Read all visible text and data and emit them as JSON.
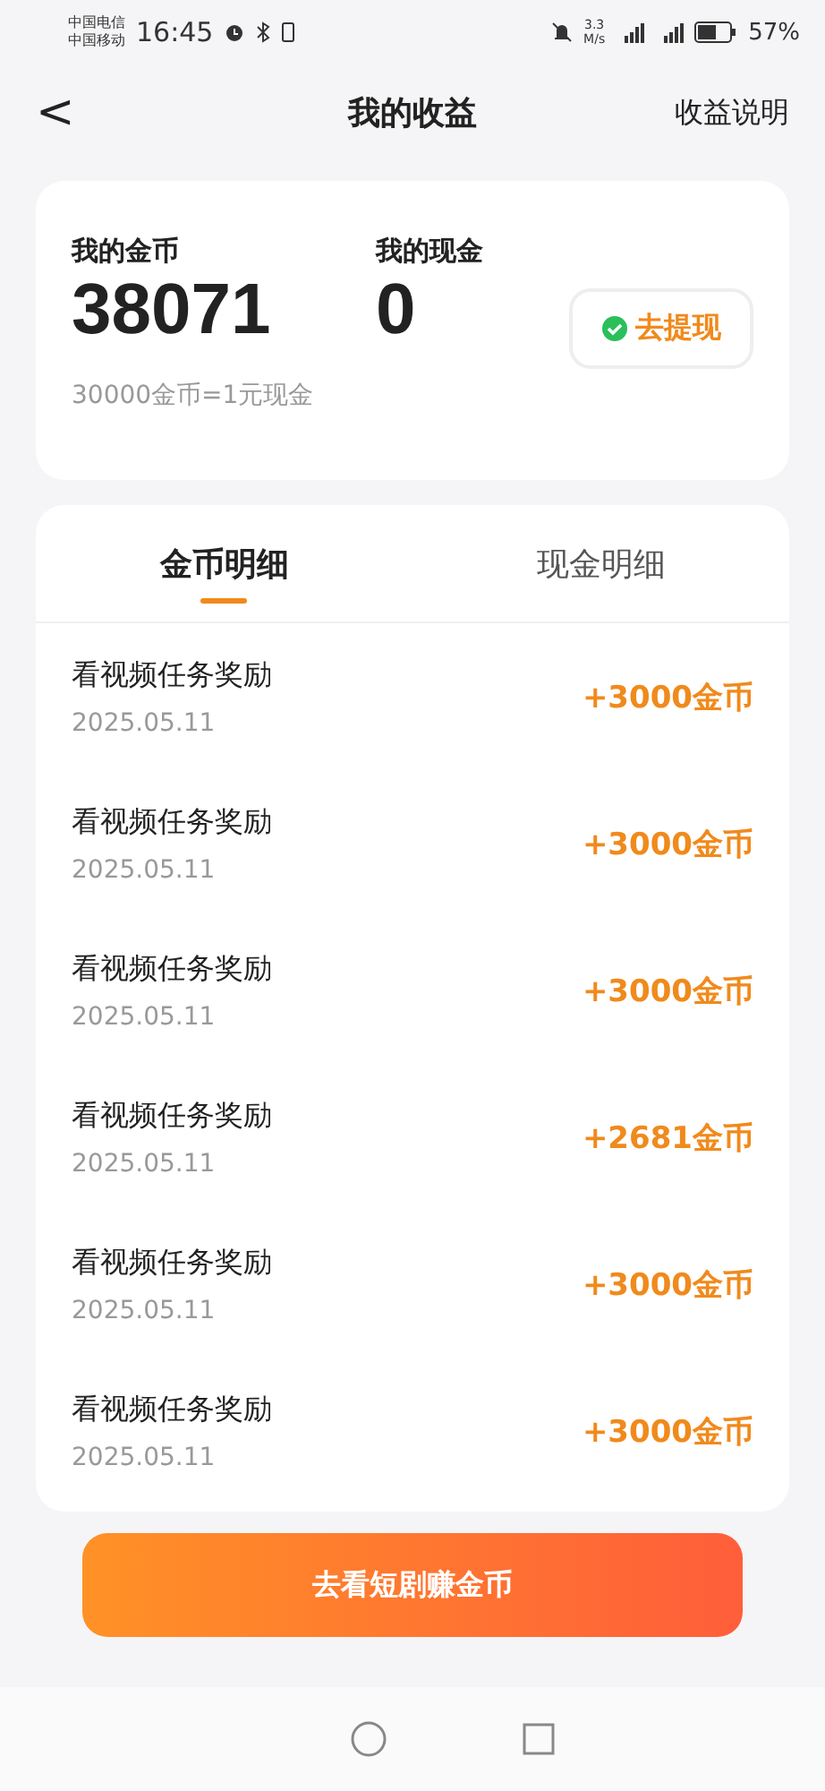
{
  "status_bar": {
    "carriers": [
      "中国电信",
      "中国移动"
    ],
    "time": "16:45",
    "speed_value": "3.3",
    "speed_unit": "M/s",
    "battery": "57%"
  },
  "header": {
    "back": "<",
    "title": "我的收益",
    "action": "收益说明"
  },
  "summary": {
    "coins_label": "我的金币",
    "coins": "38071",
    "cash_label": "我的现金",
    "cash": "0",
    "withdraw": "去提现",
    "rate": "30000金币=1元现金"
  },
  "tabs": [
    {
      "label": "金币明细",
      "selected": true
    },
    {
      "label": "现金明细",
      "selected": false
    }
  ],
  "records": [
    {
      "title": "看视频任务奖励",
      "date": "2025.05.11",
      "amount": "+3000金币"
    },
    {
      "title": "看视频任务奖励",
      "date": "2025.05.11",
      "amount": "+3000金币"
    },
    {
      "title": "看视频任务奖励",
      "date": "2025.05.11",
      "amount": "+3000金币"
    },
    {
      "title": "看视频任务奖励",
      "date": "2025.05.11",
      "amount": "+2681金币"
    },
    {
      "title": "看视频任务奖励",
      "date": "2025.05.11",
      "amount": "+3000金币"
    },
    {
      "title": "看视频任务奖励",
      "date": "2025.05.11",
      "amount": "+3000金币"
    }
  ],
  "cta": "去看短剧赚金币"
}
